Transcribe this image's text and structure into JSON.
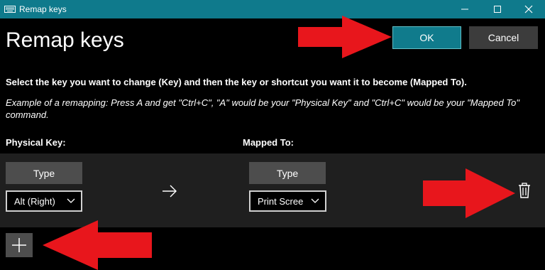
{
  "window": {
    "title": "Remap keys",
    "controls": {
      "minimize": "minimize-icon",
      "maximize": "maximize-icon",
      "close": "close-icon"
    }
  },
  "header": {
    "title": "Remap keys",
    "ok_label": "OK",
    "cancel_label": "Cancel"
  },
  "instructions": {
    "main": "Select the key you want to change (Key) and then the key or shortcut you want it to become (Mapped To).",
    "example": "Example of a remapping: Press A and get \"Ctrl+C\", \"A\" would be your \"Physical Key\" and \"Ctrl+C\" would be your \"Mapped To\" command."
  },
  "columns": {
    "physical": "Physical Key:",
    "mapped": "Mapped To:"
  },
  "mapping_row": {
    "physical_type_label": "Type",
    "physical_key": "Alt (Right)",
    "mapped_type_label": "Type",
    "mapped_key": "Print Scree"
  },
  "colors": {
    "accent": "#0f7a8c",
    "annotation_arrow": "#e8161c"
  },
  "icons": {
    "arrow": "right-arrow-icon",
    "delete": "trash-icon",
    "add": "plus-icon",
    "chevron": "chevron-down-icon"
  }
}
